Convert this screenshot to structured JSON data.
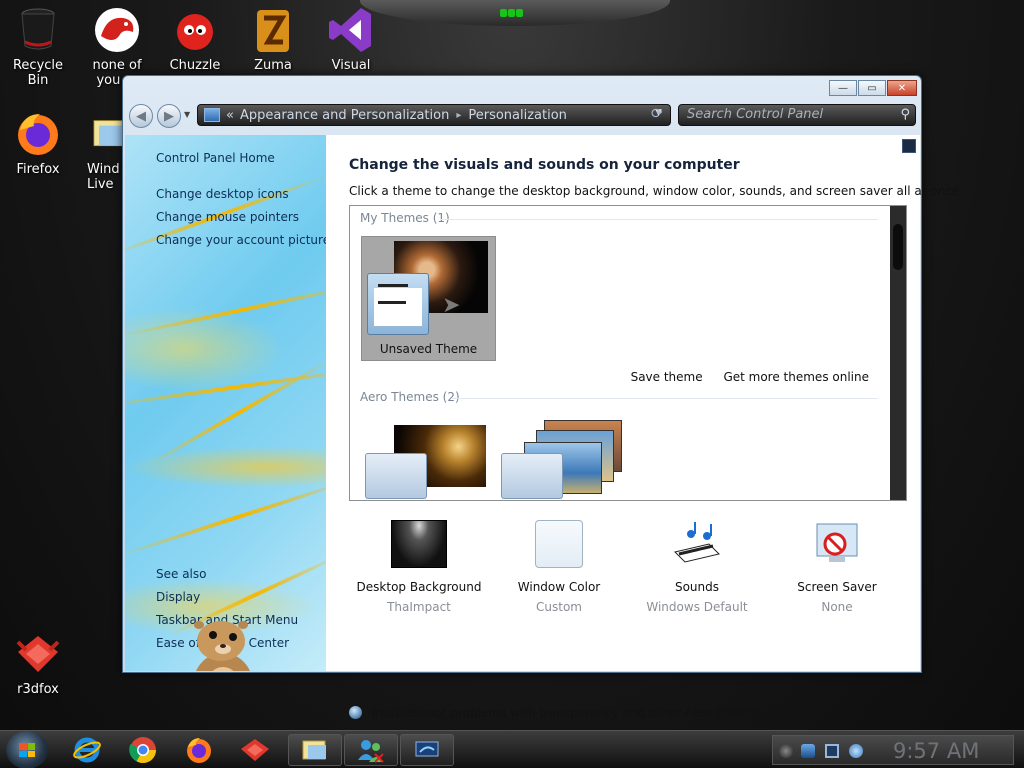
{
  "desktop": {
    "icons": [
      {
        "label": "Recycle Bin",
        "line1": "Recycle",
        "line2": "Bin",
        "icon": "recycle-bin-icon"
      },
      {
        "label": "none of you re",
        "line1": "none of",
        "line2": "you re",
        "icon": "red-fox-icon"
      },
      {
        "label": "Chuzzle",
        "line1": "Chuzzle",
        "line2": "",
        "icon": "chuzzle-icon"
      },
      {
        "label": "Zuma",
        "line1": "Zuma",
        "line2": "",
        "icon": "zuma-icon"
      },
      {
        "label": "Visual",
        "line1": "Visual",
        "line2": "",
        "icon": "visual-studio-icon"
      },
      {
        "label": "Firefox",
        "line1": "Firefox",
        "line2": "",
        "icon": "firefox-icon"
      },
      {
        "label": "Wind Live",
        "line1": "Wind",
        "line2": "Live",
        "icon": "windows-live-icon"
      },
      {
        "label": "r3dfox",
        "line1": "r3dfox",
        "line2": "",
        "icon": "r3dfox-icon"
      }
    ]
  },
  "window": {
    "buttons": {
      "minimize": "—",
      "maximize": "▭",
      "close": "✕"
    },
    "address": {
      "prefix": "«",
      "crumbs": [
        "Appearance and Personalization",
        "Personalization"
      ],
      "separator": "▸"
    },
    "search_placeholder": "Search Control Panel",
    "left_pane": {
      "home": "Control Panel Home",
      "links": [
        "Change desktop icons",
        "Change mouse pointers",
        "Change your account picture"
      ],
      "see_also_title": "See also",
      "see_also": [
        "Display",
        "Taskbar and Start Menu",
        "Ease of Access Center"
      ]
    },
    "main": {
      "title": "Change the visuals and sounds on your computer",
      "subtitle": "Click a theme to change the desktop background, window color, sounds, and screen saver all at once.",
      "my_themes_title": "My Themes (1)",
      "unsaved_theme": "Unsaved Theme",
      "save_theme": "Save theme",
      "more_themes": "Get more themes online",
      "aero_themes_title": "Aero Themes (2)",
      "options": [
        {
          "title": "Desktop Background",
          "value": "ThaImpact",
          "icon": "desktop-background-icon"
        },
        {
          "title": "Window Color",
          "value": "Custom",
          "icon": "window-color-icon"
        },
        {
          "title": "Sounds",
          "value": "Windows Default",
          "icon": "sounds-icon"
        },
        {
          "title": "Screen Saver",
          "value": "None",
          "icon": "screen-saver-icon"
        }
      ],
      "troubleshoot": "Troubleshoot problems with transparency and other Aero effects"
    }
  },
  "taskbar": {
    "pinned": [
      "internet-explorer-icon",
      "chrome-icon",
      "firefox-icon",
      "r3dfox-icon",
      "control-panel-icon",
      "users-icon",
      "display-icon"
    ],
    "clock": "9:57 AM"
  },
  "colors": {
    "accent": "#0e2f55",
    "window_frame": "#c9daea",
    "close_button": "#c8432a"
  }
}
